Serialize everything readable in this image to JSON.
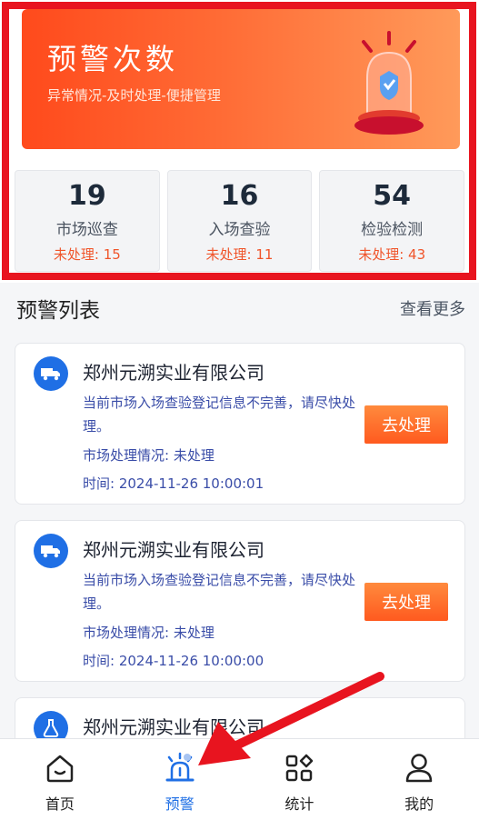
{
  "banner": {
    "title": "预警次数",
    "subtitle": "异常情况-及时处理-便捷管理"
  },
  "stats": [
    {
      "count": "19",
      "label": "市场巡查",
      "pending": "未处理: 15"
    },
    {
      "count": "16",
      "label": "入场查验",
      "pending": "未处理: 11"
    },
    {
      "count": "54",
      "label": "检验检测",
      "pending": "未处理: 43"
    }
  ],
  "list": {
    "title": "预警列表",
    "more": "查看更多"
  },
  "alerts": [
    {
      "icon": "truck-icon",
      "company": "郑州元溯实业有限公司",
      "desc": "当前市场入场查验登记信息不完善，请尽快处理。",
      "status": "市场处理情况: 未处理",
      "time": "时间: 2024-11-26 10:00:01",
      "action": "去处理"
    },
    {
      "icon": "truck-icon",
      "company": "郑州元溯实业有限公司",
      "desc": "当前市场入场查验登记信息不完善，请尽快处理。",
      "status": "市场处理情况: 未处理",
      "time": "时间: 2024-11-26 10:00:00",
      "action": "去处理"
    },
    {
      "icon": "flask-icon",
      "company": "郑州元溯实业有限公司"
    }
  ],
  "tabs": [
    {
      "label": "首页",
      "icon": "home-icon"
    },
    {
      "label": "预警",
      "icon": "siren-icon",
      "active": true
    },
    {
      "label": "统计",
      "icon": "grid-icon"
    },
    {
      "label": "我的",
      "icon": "user-icon"
    }
  ],
  "colors": {
    "accent": "#1f6fe5",
    "warning": "#f0552b",
    "annotation": "#e8141f"
  }
}
